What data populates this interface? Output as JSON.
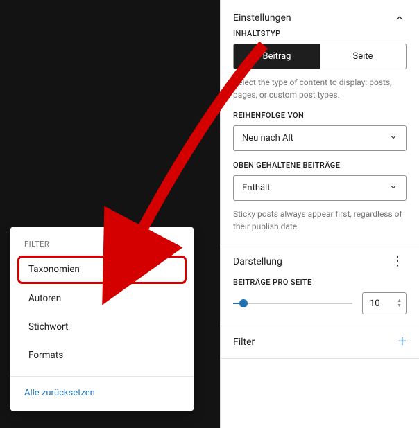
{
  "popup": {
    "header": "FILTER",
    "items": [
      "Taxonomien",
      "Autoren",
      "Stichwort",
      "Formats"
    ],
    "reset": "Alle zurücksetzen"
  },
  "settings": {
    "title": "Einstellungen",
    "content_type": {
      "label": "INHALTSTYP",
      "options": [
        "Beitrag",
        "Seite"
      ],
      "active_index": 0,
      "help": "Select the type of content to display: posts, pages, or custom post types."
    },
    "order": {
      "label": "REIHENFOLGE VON",
      "value": "Neu nach Alt"
    },
    "sticky": {
      "label": "OBEN GEHALTENE BEITRÄGE",
      "value": "Enthält",
      "help": "Sticky posts always appear first, regardless of their publish date."
    }
  },
  "display": {
    "title": "Darstellung",
    "per_page_label": "BEITRÄGE PRO SEITE",
    "per_page_value": "10"
  },
  "filter_row": {
    "title": "Filter"
  },
  "annotation": {
    "highlight_index": 0
  }
}
